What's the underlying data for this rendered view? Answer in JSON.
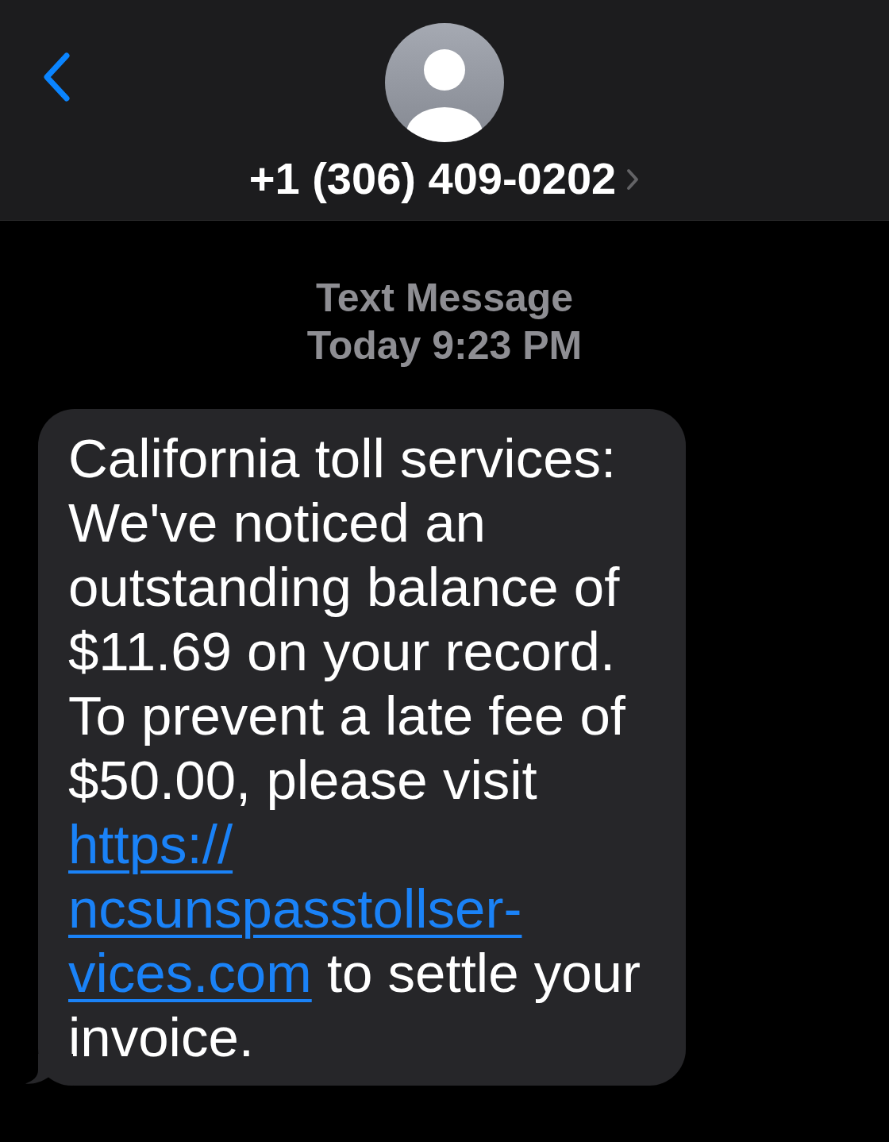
{
  "header": {
    "contact": "+1 (306) 409-0202"
  },
  "conversation": {
    "service": "Text Message",
    "timestamp": "Today 9:23 PM"
  },
  "messages": [
    {
      "kind": "incoming",
      "parts": [
        {
          "kind": "text",
          "text": "California toll services: We've noticed an outstanding balance of $11.69 on your record. To prevent a late fee of $50.00, please visit"
        },
        {
          "kind": "link",
          "lines": [
            "https://",
            "ncsunspasstollser-",
            "vices.com"
          ]
        },
        {
          "kind": "text",
          "text": "to settle your invoice."
        }
      ]
    }
  ]
}
